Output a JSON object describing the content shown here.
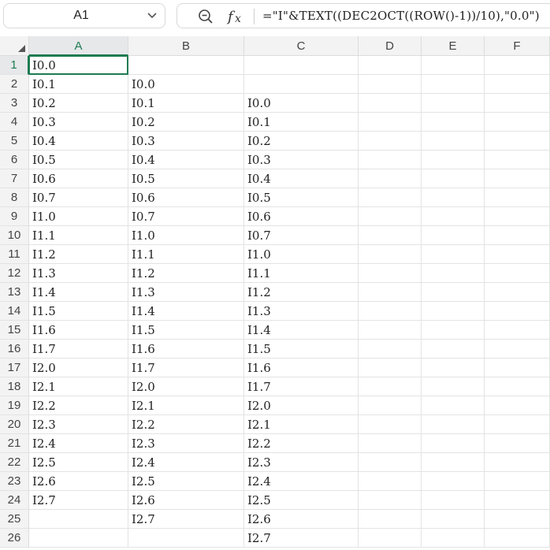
{
  "formula_bar": {
    "cell_reference": "A1",
    "formula": "=\"I\"&TEXT((DEC2OCT((ROW()-1))/10),\"0.0\")",
    "icons": {
      "namebox_dropdown": "chevron-down-icon",
      "zoom": "zoom-out-icon",
      "function": "fx-icon"
    }
  },
  "sheet": {
    "columns": [
      "A",
      "B",
      "C",
      "D",
      "E",
      "F"
    ],
    "rows": [
      "1",
      "2",
      "3",
      "4",
      "5",
      "6",
      "7",
      "8",
      "9",
      "10",
      "11",
      "12",
      "13",
      "14",
      "15",
      "16",
      "17",
      "18",
      "19",
      "20",
      "21",
      "22",
      "23",
      "24",
      "25",
      "26"
    ],
    "selected_cell": "A1",
    "active_column": "A",
    "active_row": "1",
    "cells": {
      "A": [
        "I0.0",
        "I0.1",
        "I0.2",
        "I0.3",
        "I0.4",
        "I0.5",
        "I0.6",
        "I0.7",
        "I1.0",
        "I1.1",
        "I1.2",
        "I1.3",
        "I1.4",
        "I1.5",
        "I1.6",
        "I1.7",
        "I2.0",
        "I2.1",
        "I2.2",
        "I2.3",
        "I2.4",
        "I2.5",
        "I2.6",
        "I2.7",
        "",
        ""
      ],
      "B": [
        "",
        "I0.0",
        "I0.1",
        "I0.2",
        "I0.3",
        "I0.4",
        "I0.5",
        "I0.6",
        "I0.7",
        "I1.0",
        "I1.1",
        "I1.2",
        "I1.3",
        "I1.4",
        "I1.5",
        "I1.6",
        "I1.7",
        "I2.0",
        "I2.1",
        "I2.2",
        "I2.3",
        "I2.4",
        "I2.5",
        "I2.6",
        "I2.7",
        ""
      ],
      "C": [
        "",
        "",
        "I0.0",
        "I0.1",
        "I0.2",
        "I0.3",
        "I0.4",
        "I0.5",
        "I0.6",
        "I0.7",
        "I1.0",
        "I1.1",
        "I1.2",
        "I1.3",
        "I1.4",
        "I1.5",
        "I1.6",
        "I1.7",
        "I2.0",
        "I2.1",
        "I2.2",
        "I2.3",
        "I2.4",
        "I2.5",
        "I2.6",
        "I2.7"
      ],
      "D": [
        "",
        "",
        "",
        "",
        "",
        "",
        "",
        "",
        "",
        "",
        "",
        "",
        "",
        "",
        "",
        "",
        "",
        "",
        "",
        "",
        "",
        "",
        "",
        "",
        "",
        ""
      ],
      "E": [
        "",
        "",
        "",
        "",
        "",
        "",
        "",
        "",
        "",
        "",
        "",
        "",
        "",
        "",
        "",
        "",
        "",
        "",
        "",
        "",
        "",
        "",
        "",
        "",
        "",
        ""
      ],
      "F": [
        "",
        "",
        "",
        "",
        "",
        "",
        "",
        "",
        "",
        "",
        "",
        "",
        "",
        "",
        "",
        "",
        "",
        "",
        "",
        "",
        "",
        "",
        "",
        "",
        "",
        ""
      ]
    },
    "accent_color": "#1e7b52"
  }
}
